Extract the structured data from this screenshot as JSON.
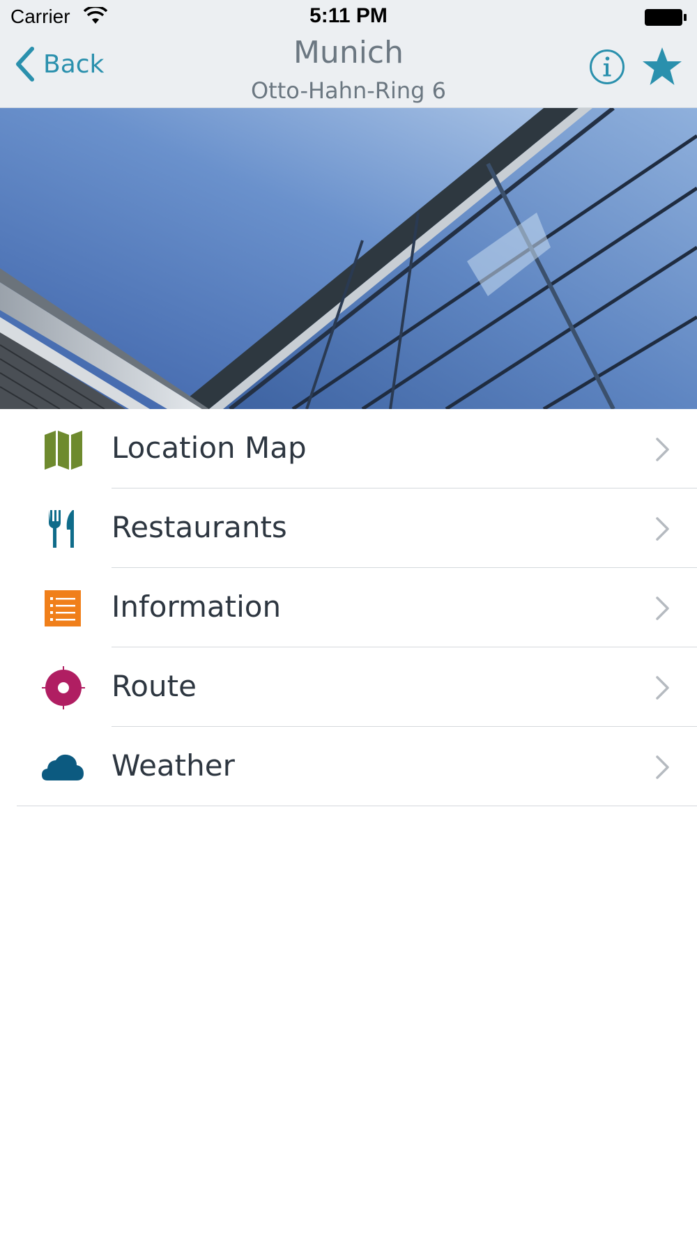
{
  "status_bar": {
    "carrier": "Carrier",
    "time": "5:11 PM"
  },
  "nav": {
    "back_label": "Back",
    "title": "Munich",
    "subtitle": "Otto-Hahn-Ring 6",
    "info_icon": "info-circle-icon",
    "favorite_icon": "star-icon"
  },
  "colors": {
    "accent": "#2a90ad",
    "map": "#6e8a2e",
    "restaurant": "#0f6c8a",
    "information": "#f07f1a",
    "route": "#b01e62",
    "weather": "#0c5a80"
  },
  "menu": {
    "items": [
      {
        "label": "Location Map",
        "icon": "map-icon"
      },
      {
        "label": "Restaurants",
        "icon": "fork-knife-icon"
      },
      {
        "label": "Information",
        "icon": "list-icon"
      },
      {
        "label": "Route",
        "icon": "target-icon"
      },
      {
        "label": "Weather",
        "icon": "cloud-icon"
      }
    ]
  }
}
